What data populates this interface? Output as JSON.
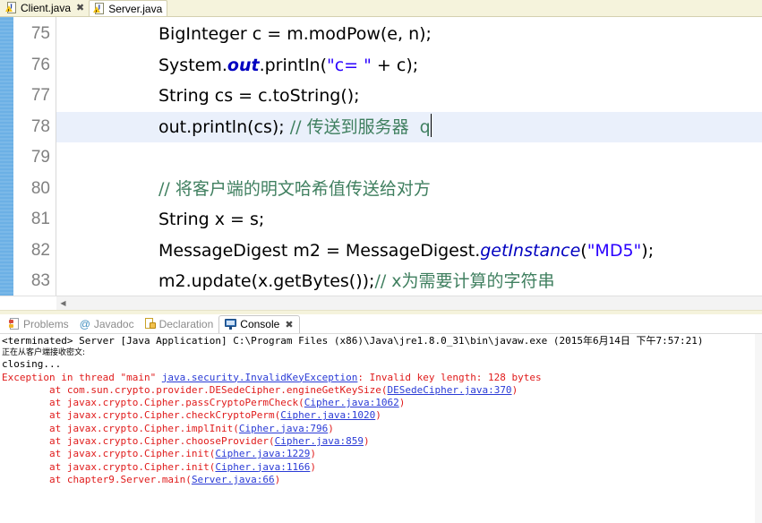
{
  "editor_tabs": [
    {
      "label": "Client.java",
      "icon": "java-file-warning-icon",
      "active": false,
      "close": "✖"
    },
    {
      "label": "Server.java",
      "icon": "java-file-warning-icon",
      "active": true,
      "close": ""
    }
  ],
  "editor": {
    "line_numbers": [
      "75",
      "76",
      "77",
      "78",
      "79",
      "80",
      "81",
      "82",
      "83"
    ],
    "highlighted_line": "78",
    "lines": [
      {
        "number": "75",
        "text": "BigInteger c = m.modPow(e, n);",
        "parts": [
          {
            "t": "BigInteger c = m.modPow(e, n);",
            "c": "plain"
          }
        ]
      },
      {
        "number": "76",
        "text": "System.out.println(\"c= \" + c);",
        "parts": [
          {
            "t": "System.",
            "c": "plain"
          },
          {
            "t": "out",
            "c": "static"
          },
          {
            "t": ".println(",
            "c": "plain"
          },
          {
            "t": "\"c= \"",
            "c": "string"
          },
          {
            "t": " + c);",
            "c": "plain"
          }
        ]
      },
      {
        "number": "77",
        "text": "String cs = c.toString();",
        "parts": [
          {
            "t": "String cs = c.toString();",
            "c": "plain"
          }
        ]
      },
      {
        "number": "78",
        "text": "out.println(cs); // 传送到服务器  q",
        "parts": [
          {
            "t": "out.println(cs); ",
            "c": "plain"
          },
          {
            "t": "// 传送到服务器  q",
            "c": "comment"
          }
        ]
      },
      {
        "number": "79",
        "text": "",
        "parts": []
      },
      {
        "number": "80",
        "text": "// 将客户端的明文哈希值传送给对方",
        "parts": [
          {
            "t": "// 将客户端的明文哈希值传送给对方",
            "c": "comment"
          }
        ]
      },
      {
        "number": "81",
        "text": "String x = s;",
        "parts": [
          {
            "t": "String x = s;",
            "c": "plain"
          }
        ]
      },
      {
        "number": "82",
        "text": "MessageDigest m2 = MessageDigest.getInstance(\"MD5\");",
        "parts": [
          {
            "t": "MessageDigest m2 = MessageDigest.",
            "c": "plain"
          },
          {
            "t": "getInstance",
            "c": "field"
          },
          {
            "t": "(",
            "c": "plain"
          },
          {
            "t": "\"MD5\"",
            "c": "string"
          },
          {
            "t": ");",
            "c": "plain"
          }
        ]
      },
      {
        "number": "83",
        "text": "m2.update(x.getBytes());// x为需要计算的字符串",
        "parts": [
          {
            "t": "m2.update(x.getBytes());",
            "c": "plain"
          },
          {
            "t": "// x为需要计算的字符串",
            "c": "comment"
          }
        ]
      }
    ]
  },
  "view_tabs": [
    {
      "label": "Problems",
      "icon": "problems-icon",
      "active": false
    },
    {
      "label": "Javadoc",
      "icon": "javadoc-at-icon",
      "active": false
    },
    {
      "label": "Declaration",
      "icon": "declaration-icon",
      "active": false
    },
    {
      "label": "Console",
      "icon": "console-icon",
      "active": true,
      "close": "✖"
    }
  ],
  "console": {
    "header": "<terminated> Server [Java Application] C:\\Program Files (x86)\\Java\\jre1.8.0_31\\bin\\javaw.exe (2015年6月14日 下午7:57:21)",
    "lines": [
      {
        "style": "small-cn",
        "segments": [
          {
            "t": "正在从客户端接收密文:",
            "c": "black"
          }
        ]
      },
      {
        "style": "mono",
        "segments": [
          {
            "t": "closing...",
            "c": "black"
          }
        ]
      },
      {
        "style": "mono",
        "segments": [
          {
            "t": "Exception in thread \"main\" ",
            "c": "err"
          },
          {
            "t": "java.security.InvalidKeyException",
            "c": "link"
          },
          {
            "t": ": Invalid key length: 128 bytes",
            "c": "err"
          }
        ]
      },
      {
        "style": "mono",
        "segments": [
          {
            "t": "\tat com.sun.crypto.provider.DESedeCipher.engineGetKeySize(",
            "c": "err"
          },
          {
            "t": "DESedeCipher.java:370",
            "c": "link"
          },
          {
            "t": ")",
            "c": "err"
          }
        ]
      },
      {
        "style": "mono",
        "segments": [
          {
            "t": "\tat javax.crypto.Cipher.passCryptoPermCheck(",
            "c": "err"
          },
          {
            "t": "Cipher.java:1062",
            "c": "link"
          },
          {
            "t": ")",
            "c": "err"
          }
        ]
      },
      {
        "style": "mono",
        "segments": [
          {
            "t": "\tat javax.crypto.Cipher.checkCryptoPerm(",
            "c": "err"
          },
          {
            "t": "Cipher.java:1020",
            "c": "link"
          },
          {
            "t": ")",
            "c": "err"
          }
        ]
      },
      {
        "style": "mono",
        "segments": [
          {
            "t": "\tat javax.crypto.Cipher.implInit(",
            "c": "err"
          },
          {
            "t": "Cipher.java:796",
            "c": "link"
          },
          {
            "t": ")",
            "c": "err"
          }
        ]
      },
      {
        "style": "mono",
        "segments": [
          {
            "t": "\tat javax.crypto.Cipher.chooseProvider(",
            "c": "err"
          },
          {
            "t": "Cipher.java:859",
            "c": "link"
          },
          {
            "t": ")",
            "c": "err"
          }
        ]
      },
      {
        "style": "mono",
        "segments": [
          {
            "t": "\tat javax.crypto.Cipher.init(",
            "c": "err"
          },
          {
            "t": "Cipher.java:1229",
            "c": "link"
          },
          {
            "t": ")",
            "c": "err"
          }
        ]
      },
      {
        "style": "mono",
        "segments": [
          {
            "t": "\tat javax.crypto.Cipher.init(",
            "c": "err"
          },
          {
            "t": "Cipher.java:1166",
            "c": "link"
          },
          {
            "t": ")",
            "c": "err"
          }
        ]
      },
      {
        "style": "mono",
        "segments": [
          {
            "t": "\tat chapter9.Server.main(",
            "c": "err"
          },
          {
            "t": "Server.java:66",
            "c": "link"
          },
          {
            "t": ")",
            "c": "err"
          }
        ]
      }
    ]
  },
  "colors": {
    "tab_bar": "#f5f3dc",
    "change_bar": "#6cb0e5",
    "highlight_line": "#eaf0fb",
    "comment": "#3f7f5f",
    "string": "#2a00ff",
    "error": "#e01b1b",
    "link": "#2a3bd6"
  }
}
